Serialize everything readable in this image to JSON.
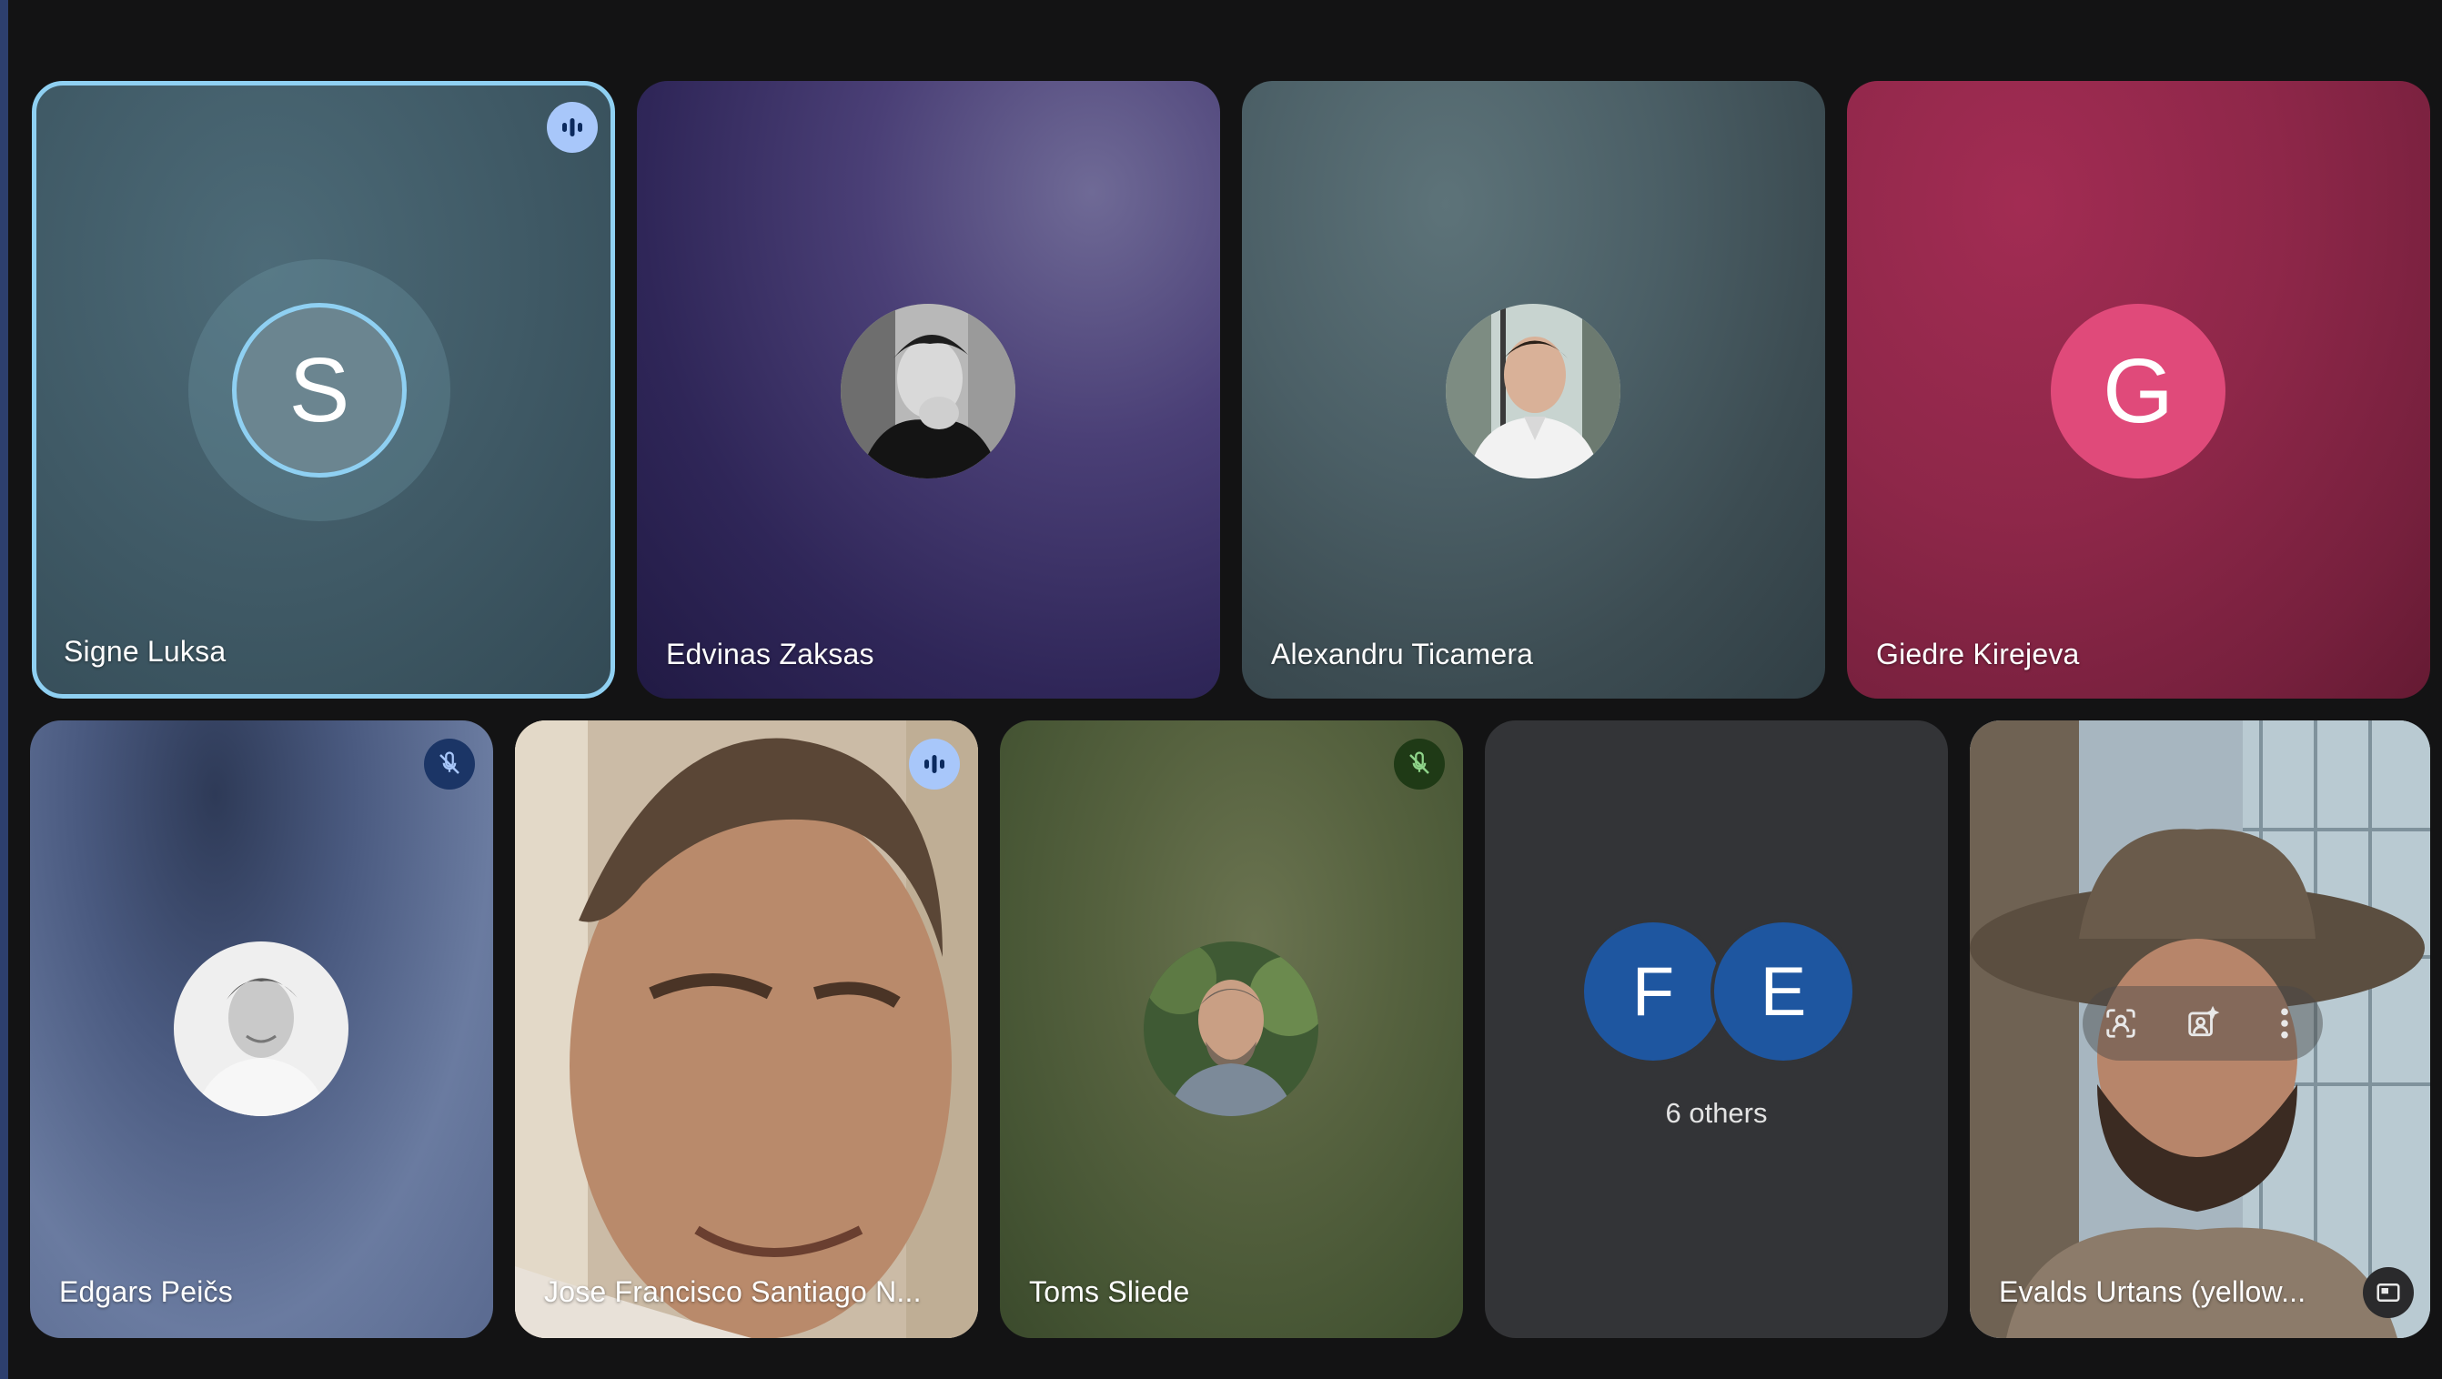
{
  "participants_row1": [
    {
      "name": "Signe Luksa",
      "initial": "S"
    },
    {
      "name": "Edvinas Zaksas"
    },
    {
      "name": "Alexandru Ticamera"
    },
    {
      "name": "Giedre Kirejeva",
      "initial": "G"
    }
  ],
  "participants_row2": [
    {
      "name": "Edgars Peičs"
    },
    {
      "name": "Jose Francisco Santiago N..."
    },
    {
      "name": "Toms Sliede"
    },
    {
      "name": "Evalds Urtans (yellow..."
    }
  ],
  "others": {
    "initials": [
      "F",
      "E"
    ],
    "label": "6 others"
  },
  "colors": {
    "active_speaker_border": "#8fd0f2",
    "giedre_avatar": "#e04a7a",
    "others_avatar": "#1e56a0",
    "speaking_badge": "#a8c7fa",
    "muted_badge": "#1b3566"
  }
}
